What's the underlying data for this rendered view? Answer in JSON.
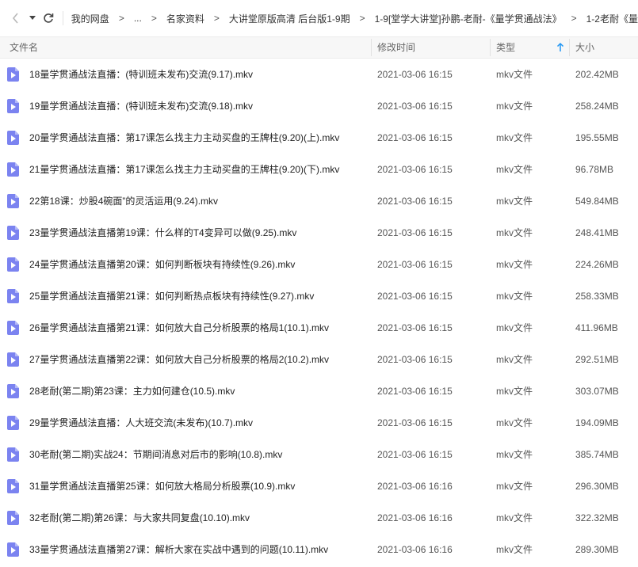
{
  "nav": {
    "back_icon": "chevron-left-icon",
    "forward_icon": "caret-down-icon",
    "refresh_icon": "refresh-icon"
  },
  "breadcrumb": [
    "我的网盘",
    "...",
    "名家资料",
    "大讲堂原版高清 后台版1-9期",
    "1-9[堂学大讲堂]孙鹏-老耐-《量学贯通战法》",
    "1-2老耐《量"
  ],
  "columns": {
    "name": "文件名",
    "modified": "修改时间",
    "type": "类型",
    "size": "大小"
  },
  "colors": {
    "accent": "#2196f3",
    "video_icon": "#7b83f0"
  },
  "files": [
    {
      "name": "18量学贯通战法直播：(特训班未发布)交流(9.17).mkv",
      "date": "2021-03-06 16:15",
      "type": "mkv文件",
      "size": "202.42MB"
    },
    {
      "name": "19量学贯通战法直播：(特训班未发布)交流(9.18).mkv",
      "date": "2021-03-06 16:15",
      "type": "mkv文件",
      "size": "258.24MB"
    },
    {
      "name": "20量学贯通战法直播：第17课怎么找主力主动买盘的王牌柱(9.20)(上).mkv",
      "date": "2021-03-06 16:15",
      "type": "mkv文件",
      "size": "195.55MB"
    },
    {
      "name": "21量学贯通战法直播：第17课怎么找主力主动买盘的王牌柱(9.20)(下).mkv",
      "date": "2021-03-06 16:15",
      "type": "mkv文件",
      "size": "96.78MB"
    },
    {
      "name": "22第18课：炒股4碗面”的灵活运用(9.24).mkv",
      "date": "2021-03-06 16:15",
      "type": "mkv文件",
      "size": "549.84MB"
    },
    {
      "name": "23量学贯通战法直播第19课：什么样的T4变异可以做(9.25).mkv",
      "date": "2021-03-06 16:15",
      "type": "mkv文件",
      "size": "248.41MB"
    },
    {
      "name": "24量学贯通战法直播第20课：如何判断板块有持续性(9.26).mkv",
      "date": "2021-03-06 16:15",
      "type": "mkv文件",
      "size": "224.26MB"
    },
    {
      "name": "25量学贯通战法直播第21课：如何判断热点板块有持续性(9.27).mkv",
      "date": "2021-03-06 16:15",
      "type": "mkv文件",
      "size": "258.33MB"
    },
    {
      "name": "26量学贯通战法直播第21课：如何放大自己分析股票的格局1(10.1).mkv",
      "date": "2021-03-06 16:15",
      "type": "mkv文件",
      "size": "411.96MB"
    },
    {
      "name": "27量学贯通战法直播第22课：如何放大自己分析股票的格局2(10.2).mkv",
      "date": "2021-03-06 16:15",
      "type": "mkv文件",
      "size": "292.51MB"
    },
    {
      "name": "28老耐(第二期)第23课：主力如何建仓(10.5).mkv",
      "date": "2021-03-06 16:15",
      "type": "mkv文件",
      "size": "303.07MB"
    },
    {
      "name": "29量学贯通战法直播：人大班交流(未发布)(10.7).mkv",
      "date": "2021-03-06 16:15",
      "type": "mkv文件",
      "size": "194.09MB"
    },
    {
      "name": "30老耐(第二期)实战24：节期间消息对后市的影响(10.8).mkv",
      "date": "2021-03-06 16:15",
      "type": "mkv文件",
      "size": "385.74MB"
    },
    {
      "name": "31量学贯通战法直播第25课：如何放大格局分析股票(10.9).mkv",
      "date": "2021-03-06 16:16",
      "type": "mkv文件",
      "size": "296.30MB"
    },
    {
      "name": "32老耐(第二期)第26课：与大家共同复盘(10.10).mkv",
      "date": "2021-03-06 16:16",
      "type": "mkv文件",
      "size": "322.32MB"
    },
    {
      "name": "33量学贯通战法直播第27课：解析大家在实战中遇到的问题(10.11).mkv",
      "date": "2021-03-06 16:16",
      "type": "mkv文件",
      "size": "289.30MB"
    }
  ]
}
